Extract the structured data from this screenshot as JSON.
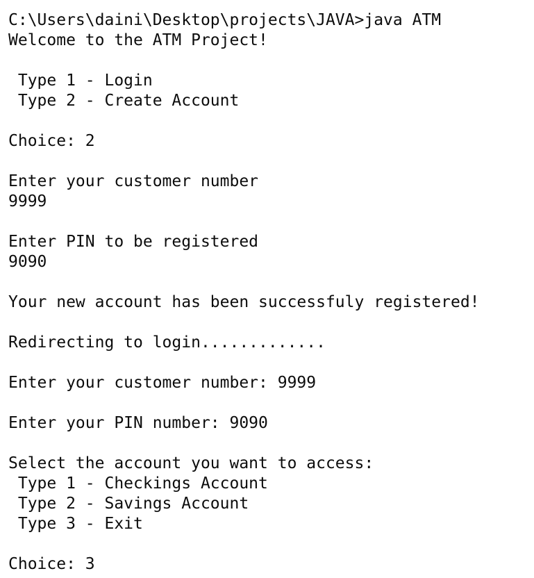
{
  "terminal": {
    "lines": [
      "C:\\Users\\daini\\Desktop\\projects\\JAVA>java ATM",
      "Welcome to the ATM Project!",
      "",
      " Type 1 - Login",
      " Type 2 - Create Account",
      "",
      "Choice: 2",
      "",
      "Enter your customer number",
      "9999",
      "",
      "Enter PIN to be registered",
      "9090",
      "",
      "Your new account has been successfuly registered!",
      "",
      "Redirecting to login.............",
      "",
      "Enter your customer number: 9999",
      "",
      "Enter your PIN number: 9090",
      "",
      "Select the account you want to access:",
      " Type 1 - Checkings Account",
      " Type 2 - Savings Account",
      " Type 3 - Exit",
      "",
      "Choice: 3"
    ]
  }
}
